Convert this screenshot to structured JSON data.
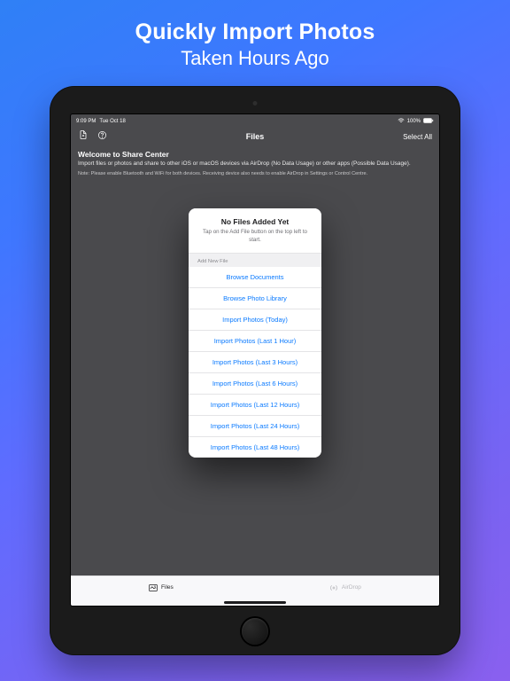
{
  "promo": {
    "title": "Quickly Import Photos",
    "subtitle": "Taken Hours Ago"
  },
  "status": {
    "time": "9:09 PM",
    "date": "Tue Oct 18",
    "wifi": "wifi",
    "battery_pct": "100%"
  },
  "nav": {
    "title": "Files",
    "select_all": "Select All"
  },
  "intro": {
    "title": "Welcome to Share Center",
    "desc": "Import files or photos and share to other iOS or macOS devices via AirDrop (No Data Usage) or other apps (Possible Data Usage).",
    "note": "Note: Please enable Bluetooth and WiFi for both devices. Receiving device also needs to enable AirDrop in Settings or Control Centre."
  },
  "popover": {
    "head_title": "No Files Added Yet",
    "head_sub": "Tap on the Add File button on the top left to start.",
    "section_header": "Add New File",
    "items": [
      "Browse Documents",
      "Browse Photo Library",
      "Import Photos (Today)",
      "Import Photos (Last 1 Hour)",
      "Import Photos (Last 3 Hours)",
      "Import Photos (Last 6 Hours)",
      "Import Photos (Last 12 Hours)",
      "Import Photos (Last 24 Hours)",
      "Import Photos (Last 48 Hours)"
    ]
  },
  "tabs": {
    "files": "Files",
    "airdrop": "AirDrop"
  }
}
